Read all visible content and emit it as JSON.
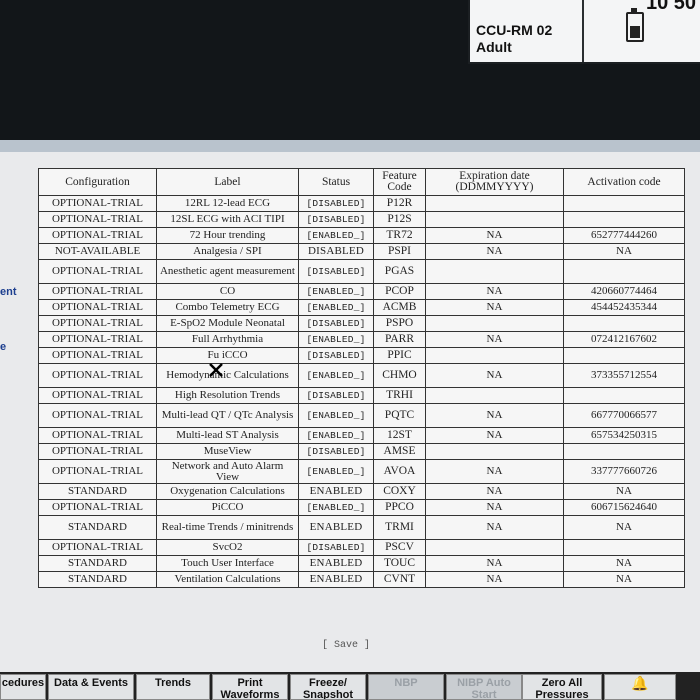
{
  "header": {
    "room": "CCU-RM 02",
    "patient_type": "Adult",
    "clock_partial": "10 50",
    "battery_icon": "battery-icon"
  },
  "left_fragments": {
    "first": "ent",
    "second": "e"
  },
  "table": {
    "headers": {
      "configuration": "Configuration",
      "label": "Label",
      "status": "Status",
      "feature_code": "Feature Code",
      "expiration": "Expiration date (DDMMYYYY)",
      "activation": "Activation code"
    },
    "rows": [
      {
        "config": "OPTIONAL-TRIAL",
        "label": "12RL 12-lead ECG",
        "status": "[DISABLED]",
        "code": "P12R",
        "exp": "",
        "act": ""
      },
      {
        "config": "OPTIONAL-TRIAL",
        "label": "12SL ECG with ACI TIPI",
        "status": "[DISABLED]",
        "code": "P12S",
        "exp": "",
        "act": ""
      },
      {
        "config": "OPTIONAL-TRIAL",
        "label": "72 Hour trending",
        "status": "[ENABLED_]",
        "code": "TR72",
        "exp": "NA",
        "act": "652777444260"
      },
      {
        "config": "NOT-AVAILABLE",
        "label": "Analgesia / SPI",
        "status": "DISABLED",
        "code": "PSPI",
        "exp": "NA",
        "act": "NA"
      },
      {
        "config": "OPTIONAL-TRIAL",
        "label": "Anesthetic agent measurement",
        "status": "[DISABLED]",
        "code": "PGAS",
        "exp": "",
        "act": ""
      },
      {
        "config": "OPTIONAL-TRIAL",
        "label": "CO",
        "status": "[ENABLED_]",
        "code": "PCOP",
        "exp": "NA",
        "act": "420660774464"
      },
      {
        "config": "OPTIONAL-TRIAL",
        "label": "Combo Telemetry ECG",
        "status": "[ENABLED_]",
        "code": "ACMB",
        "exp": "NA",
        "act": "454452435344"
      },
      {
        "config": "OPTIONAL-TRIAL",
        "label": "E-SpO2 Module Neonatal",
        "status": "[DISABLED]",
        "code": "PSPO",
        "exp": "",
        "act": ""
      },
      {
        "config": "OPTIONAL-TRIAL",
        "label": "Full Arrhythmia",
        "status": "[ENABLED_]",
        "code": "PARR",
        "exp": "NA",
        "act": "072412167602"
      },
      {
        "config": "OPTIONAL-TRIAL",
        "label": "Fu  iCCO",
        "status": "[DISABLED]",
        "code": "PPIC",
        "exp": "",
        "act": ""
      },
      {
        "config": "OPTIONAL-TRIAL",
        "label": "Hemodynamic Calculations",
        "status": "[ENABLED_]",
        "code": "CHMO",
        "exp": "NA",
        "act": "373355712554"
      },
      {
        "config": "OPTIONAL-TRIAL",
        "label": "High Resolution Trends",
        "status": "[DISABLED]",
        "code": "TRHI",
        "exp": "",
        "act": ""
      },
      {
        "config": "OPTIONAL-TRIAL",
        "label": "Multi-lead QT / QTc Analysis",
        "status": "[ENABLED_]",
        "code": "PQTC",
        "exp": "NA",
        "act": "667770066577"
      },
      {
        "config": "OPTIONAL-TRIAL",
        "label": "Multi-lead ST Analysis",
        "status": "[ENABLED_]",
        "code": "12ST",
        "exp": "NA",
        "act": "657534250315"
      },
      {
        "config": "OPTIONAL-TRIAL",
        "label": "MuseView",
        "status": "[DISABLED]",
        "code": "AMSE",
        "exp": "",
        "act": ""
      },
      {
        "config": "OPTIONAL-TRIAL",
        "label": "Network and Auto Alarm View",
        "status": "[ENABLED_]",
        "code": "AVOA",
        "exp": "NA",
        "act": "337777660726"
      },
      {
        "config": "STANDARD",
        "label": "Oxygenation Calculations",
        "status": "ENABLED",
        "code": "COXY",
        "exp": "NA",
        "act": "NA"
      },
      {
        "config": "OPTIONAL-TRIAL",
        "label": "PiCCO",
        "status": "[ENABLED_]",
        "code": "PPCO",
        "exp": "NA",
        "act": "606715624640"
      },
      {
        "config": "STANDARD",
        "label": "Real-time Trends / minitrends",
        "status": "ENABLED",
        "code": "TRMI",
        "exp": "NA",
        "act": "NA"
      },
      {
        "config": "OPTIONAL-TRIAL",
        "label": "SvcO2",
        "status": "[DISABLED]",
        "code": "PSCV",
        "exp": "",
        "act": ""
      },
      {
        "config": "STANDARD",
        "label": "Touch User Interface",
        "status": "ENABLED",
        "code": "TOUC",
        "exp": "NA",
        "act": "NA"
      },
      {
        "config": "STANDARD",
        "label": "Ventilation Calculations",
        "status": "ENABLED",
        "code": "CVNT",
        "exp": "NA",
        "act": "NA"
      }
    ]
  },
  "save_label": "[ Save ]",
  "bottom_buttons": [
    {
      "label": "cedures",
      "disabled": false
    },
    {
      "label": "Data & Events",
      "disabled": false
    },
    {
      "label": "Trends",
      "disabled": false
    },
    {
      "label": "Print Waveforms",
      "disabled": false
    },
    {
      "label": "Freeze/ Snapshot",
      "disabled": false
    },
    {
      "label": "NBP",
      "disabled": true
    },
    {
      "label": "NIBP Auto Start",
      "disabled": true
    },
    {
      "label": "Zero All Pressures",
      "disabled": false
    },
    {
      "label": "",
      "icon": "alarm-bell-icon",
      "disabled": false
    }
  ]
}
